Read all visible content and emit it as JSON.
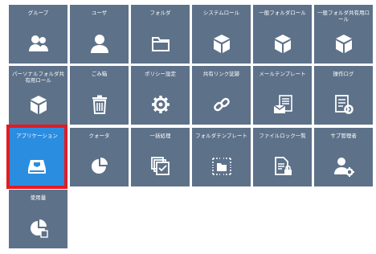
{
  "tiles": [
    {
      "id": "group",
      "label": "グループ",
      "icon": "users-icon"
    },
    {
      "id": "user",
      "label": "ユーザ",
      "icon": "user-icon"
    },
    {
      "id": "folder",
      "label": "フォルダ",
      "icon": "folder-icon"
    },
    {
      "id": "system-role",
      "label": "システムロール",
      "icon": "cube-icon"
    },
    {
      "id": "general-folder-role",
      "label": "一般フォルダロール",
      "icon": "cube-icon"
    },
    {
      "id": "general-shared-folder-role",
      "label": "一般フォルダ共有用ロール",
      "icon": "cube-icon"
    },
    {
      "id": "personal-folder-role",
      "label": "パーソナルフォルダ共有用ロール",
      "icon": "cube-icon"
    },
    {
      "id": "trash",
      "label": "ごみ箱",
      "icon": "trash-icon"
    },
    {
      "id": "policy",
      "label": "ポリシー設定",
      "icon": "gear-icon"
    },
    {
      "id": "share-link-audit",
      "label": "共有リンク証跡",
      "icon": "link-icon"
    },
    {
      "id": "mail-template",
      "label": "メールテンプレート",
      "icon": "mail-template-icon"
    },
    {
      "id": "operation-log",
      "label": "操作ログ",
      "icon": "log-icon"
    },
    {
      "id": "application",
      "label": "アプリケーション",
      "icon": "drive-icon",
      "selected": true
    },
    {
      "id": "quota",
      "label": "クォータ",
      "icon": "pie-icon"
    },
    {
      "id": "bulk-process",
      "label": "一括処理",
      "icon": "batch-icon"
    },
    {
      "id": "folder-template",
      "label": "フォルダテンプレート",
      "icon": "folder-template-icon"
    },
    {
      "id": "file-lock",
      "label": "ファイルロック一覧",
      "icon": "file-lock-icon"
    },
    {
      "id": "sub-admin",
      "label": "サブ管理者",
      "icon": "user-gear-icon"
    },
    {
      "id": "usage",
      "label": "使用量",
      "icon": "usage-pie-icon"
    }
  ],
  "colors": {
    "tile": "#5d7189",
    "selected_tile": "#2b8de0",
    "highlight_border": "#e31b23"
  }
}
